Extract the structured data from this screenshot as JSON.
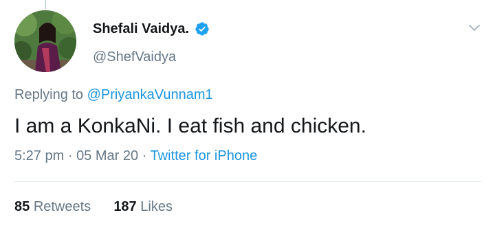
{
  "tweet": {
    "author": {
      "display_name": "Shefali Vaidya.",
      "handle": "@ShefVaidya",
      "verified": true
    },
    "replying_to_prefix": "Replying to",
    "replying_to_handle": "@PriyankaVunnam1",
    "text": "I am a KonkaNi. I eat fish and chicken.",
    "time": "5:27 pm",
    "separator": "·",
    "date": "05 Mar 20",
    "source": "Twitter for iPhone",
    "stats": {
      "retweets_count": "85",
      "retweets_label": "Retweets",
      "likes_count": "187",
      "likes_label": "Likes"
    }
  },
  "icons": {
    "verified": "verified-badge-icon",
    "caret": "chevron-down-icon"
  },
  "colors": {
    "link": "#1b95e0",
    "secondary_text": "#657786",
    "primary_text": "#14171a",
    "verified": "#1da1f2"
  }
}
